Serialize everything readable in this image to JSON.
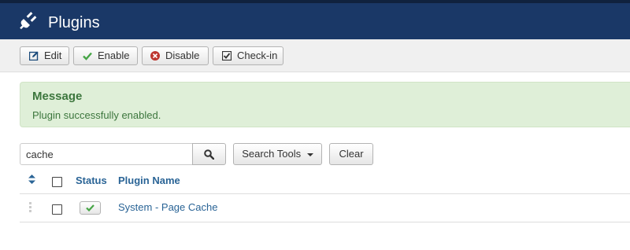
{
  "header": {
    "title": "Plugins",
    "icon": "plug-icon"
  },
  "toolbar": {
    "edit_label": "Edit",
    "enable_label": "Enable",
    "disable_label": "Disable",
    "checkin_label": "Check-in"
  },
  "message": {
    "heading": "Message",
    "text": "Plugin successfully enabled."
  },
  "search": {
    "value": "cache",
    "tools_label": "Search Tools",
    "clear_label": "Clear"
  },
  "table": {
    "headers": {
      "status": "Status",
      "name": "Plugin Name"
    },
    "rows": [
      {
        "name": "System - Page Cache",
        "status": "enabled"
      }
    ]
  },
  "colors": {
    "header_bg": "#1a3867",
    "link": "#2a6496",
    "success_text": "#3c763d",
    "success_bg": "#dfefd8",
    "enable_green": "#46a546",
    "disable_red": "#bd362f"
  }
}
